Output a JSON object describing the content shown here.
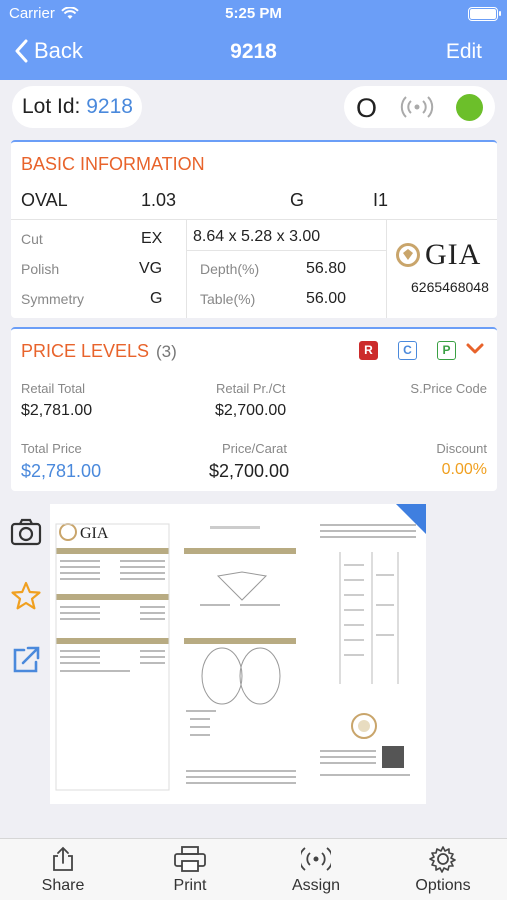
{
  "status": {
    "carrier": "Carrier",
    "time": "5:25 PM"
  },
  "nav": {
    "back_label": "Back",
    "title": "9218",
    "edit_label": "Edit"
  },
  "lot": {
    "label": "Lot Id:",
    "value": "9218",
    "status_letter": "O",
    "status_dot_color": "#6cbf2a"
  },
  "basic": {
    "title": "BASIC INFORMATION",
    "shape": "OVAL",
    "carat": "1.03",
    "color": "G",
    "clarity": "I1",
    "cut_label": "Cut",
    "cut_value": "EX",
    "polish_label": "Polish",
    "polish_value": "VG",
    "symmetry_label": "Symmetry",
    "symmetry_value": "G",
    "measurements": "8.64 x 5.28 x 3.00",
    "depth_label": "Depth(%)",
    "depth_value": "56.80",
    "table_label": "Table(%)",
    "table_value": "56.00",
    "lab": "GIA",
    "cert_number": "6265468048"
  },
  "price": {
    "title": "PRICE LEVELS",
    "count": "(3)",
    "badges": [
      "R",
      "C",
      "P"
    ],
    "retail_total_label": "Retail Total",
    "retail_total_value": "$2,781.00",
    "retail_pr_ct_label": "Retail Pr./Ct",
    "retail_pr_ct_value": "$2,700.00",
    "s_price_code_label": "S.Price Code",
    "total_price_label": "Total Price",
    "total_price_value": "$2,781.00",
    "price_carat_label": "Price/Carat",
    "price_carat_value": "$2,700.00",
    "discount_label": "Discount",
    "discount_value": "0.00%"
  },
  "tabs": [
    {
      "label": "Share",
      "icon": "share-icon"
    },
    {
      "label": "Print",
      "icon": "printer-icon"
    },
    {
      "label": "Assign",
      "icon": "rfid-icon"
    },
    {
      "label": "Options",
      "icon": "gear-icon"
    }
  ],
  "colors": {
    "accent": "#6b9ef7",
    "section_title": "#e8632b",
    "link": "#4a89dc",
    "discount": "#f0a020"
  }
}
